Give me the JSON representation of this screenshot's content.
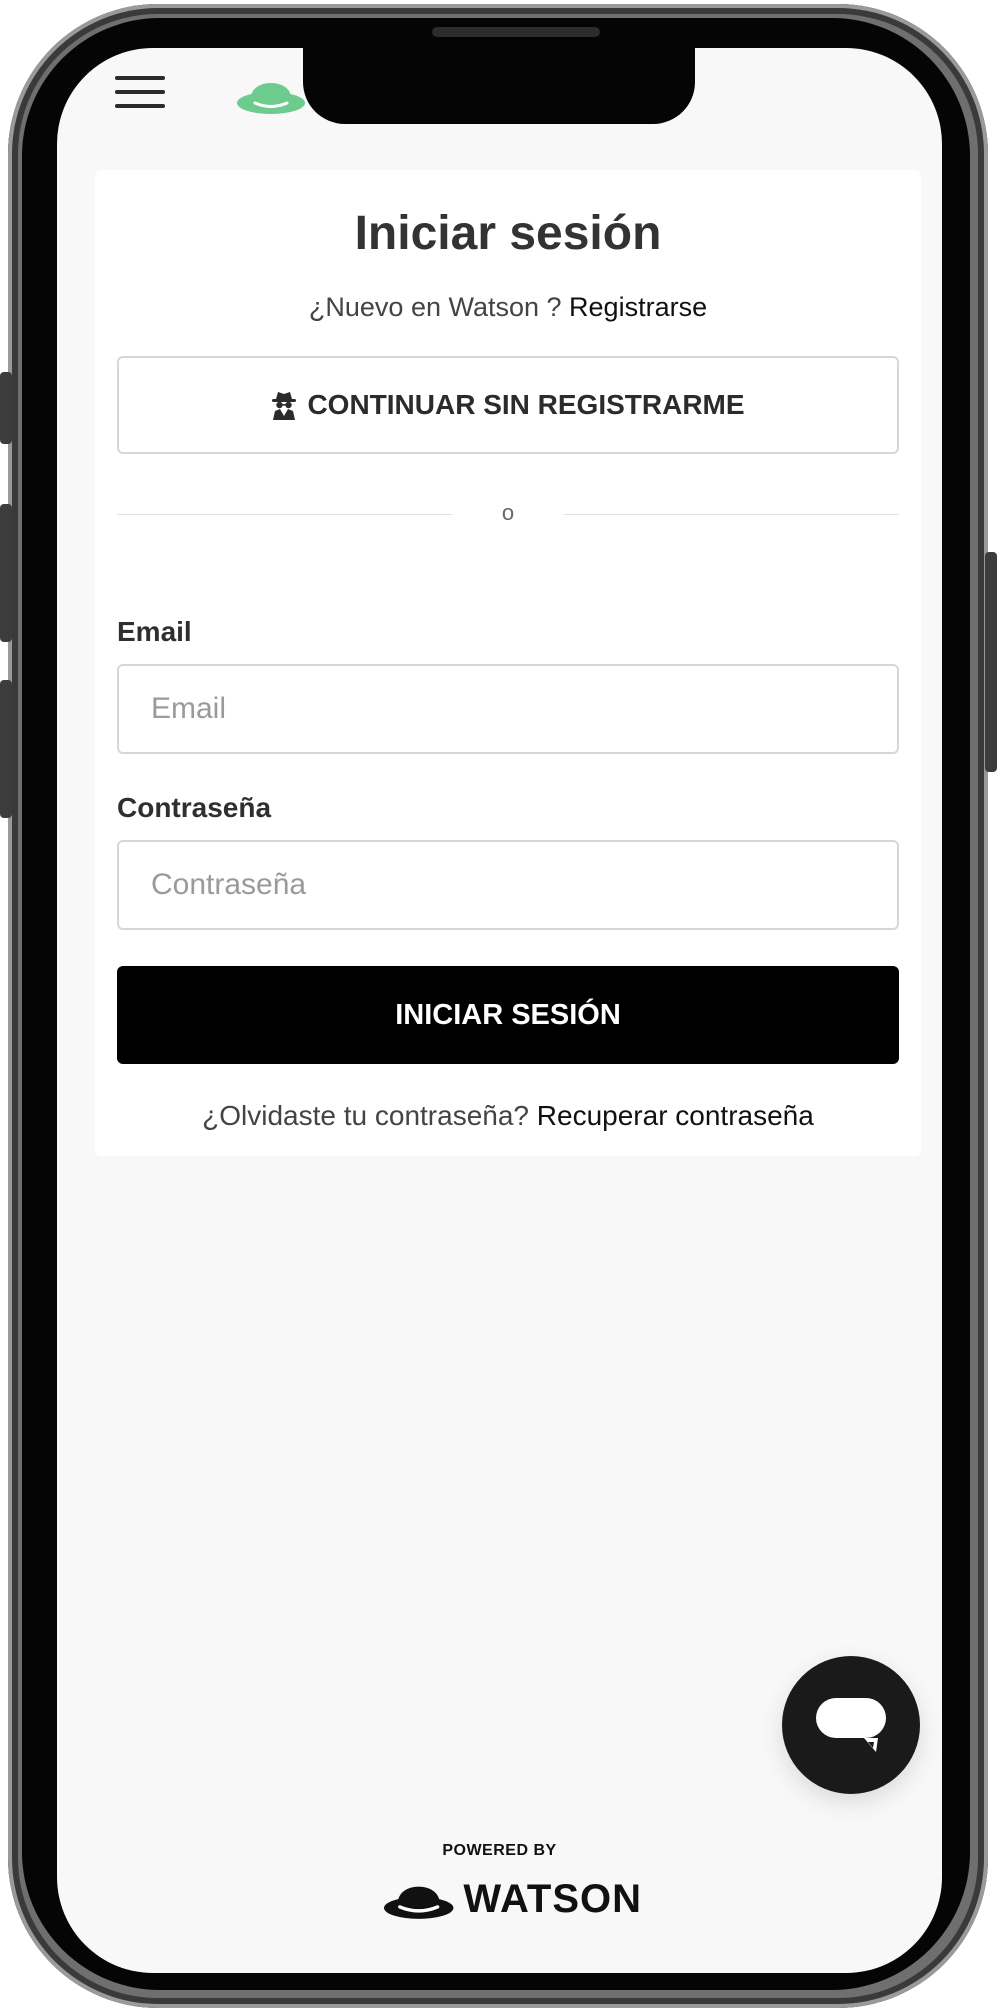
{
  "header": {
    "menu_icon": "hamburger-menu-icon",
    "logo_icon": "bowler-hat-icon",
    "logo_color": "#6dcb8d"
  },
  "login": {
    "title": "Iniciar sesión",
    "signup_prompt": "¿Nuevo en Watson ? ",
    "signup_link": "Registrarse",
    "guest_icon": "spy-icon",
    "guest_button": "CONTINUAR SIN REGISTRARME",
    "divider_text": "o",
    "email_label": "Email",
    "email_placeholder": "Email",
    "password_label": "Contraseña",
    "password_placeholder": "Contraseña",
    "submit_button": "INICIAR SESIÓN",
    "forgot_prompt": "¿Olvidaste tu contraseña? ",
    "forgot_link": "Recuperar contraseña"
  },
  "chat": {
    "icon": "chat-bubble-icon"
  },
  "footer": {
    "powered_by": "POWERED BY",
    "brand_icon": "bowler-hat-icon",
    "brand_name": "WATSON"
  },
  "colors": {
    "accent": "#6dcb8d",
    "primary_button": "#000000",
    "screen_background": "#f8f8f8"
  }
}
